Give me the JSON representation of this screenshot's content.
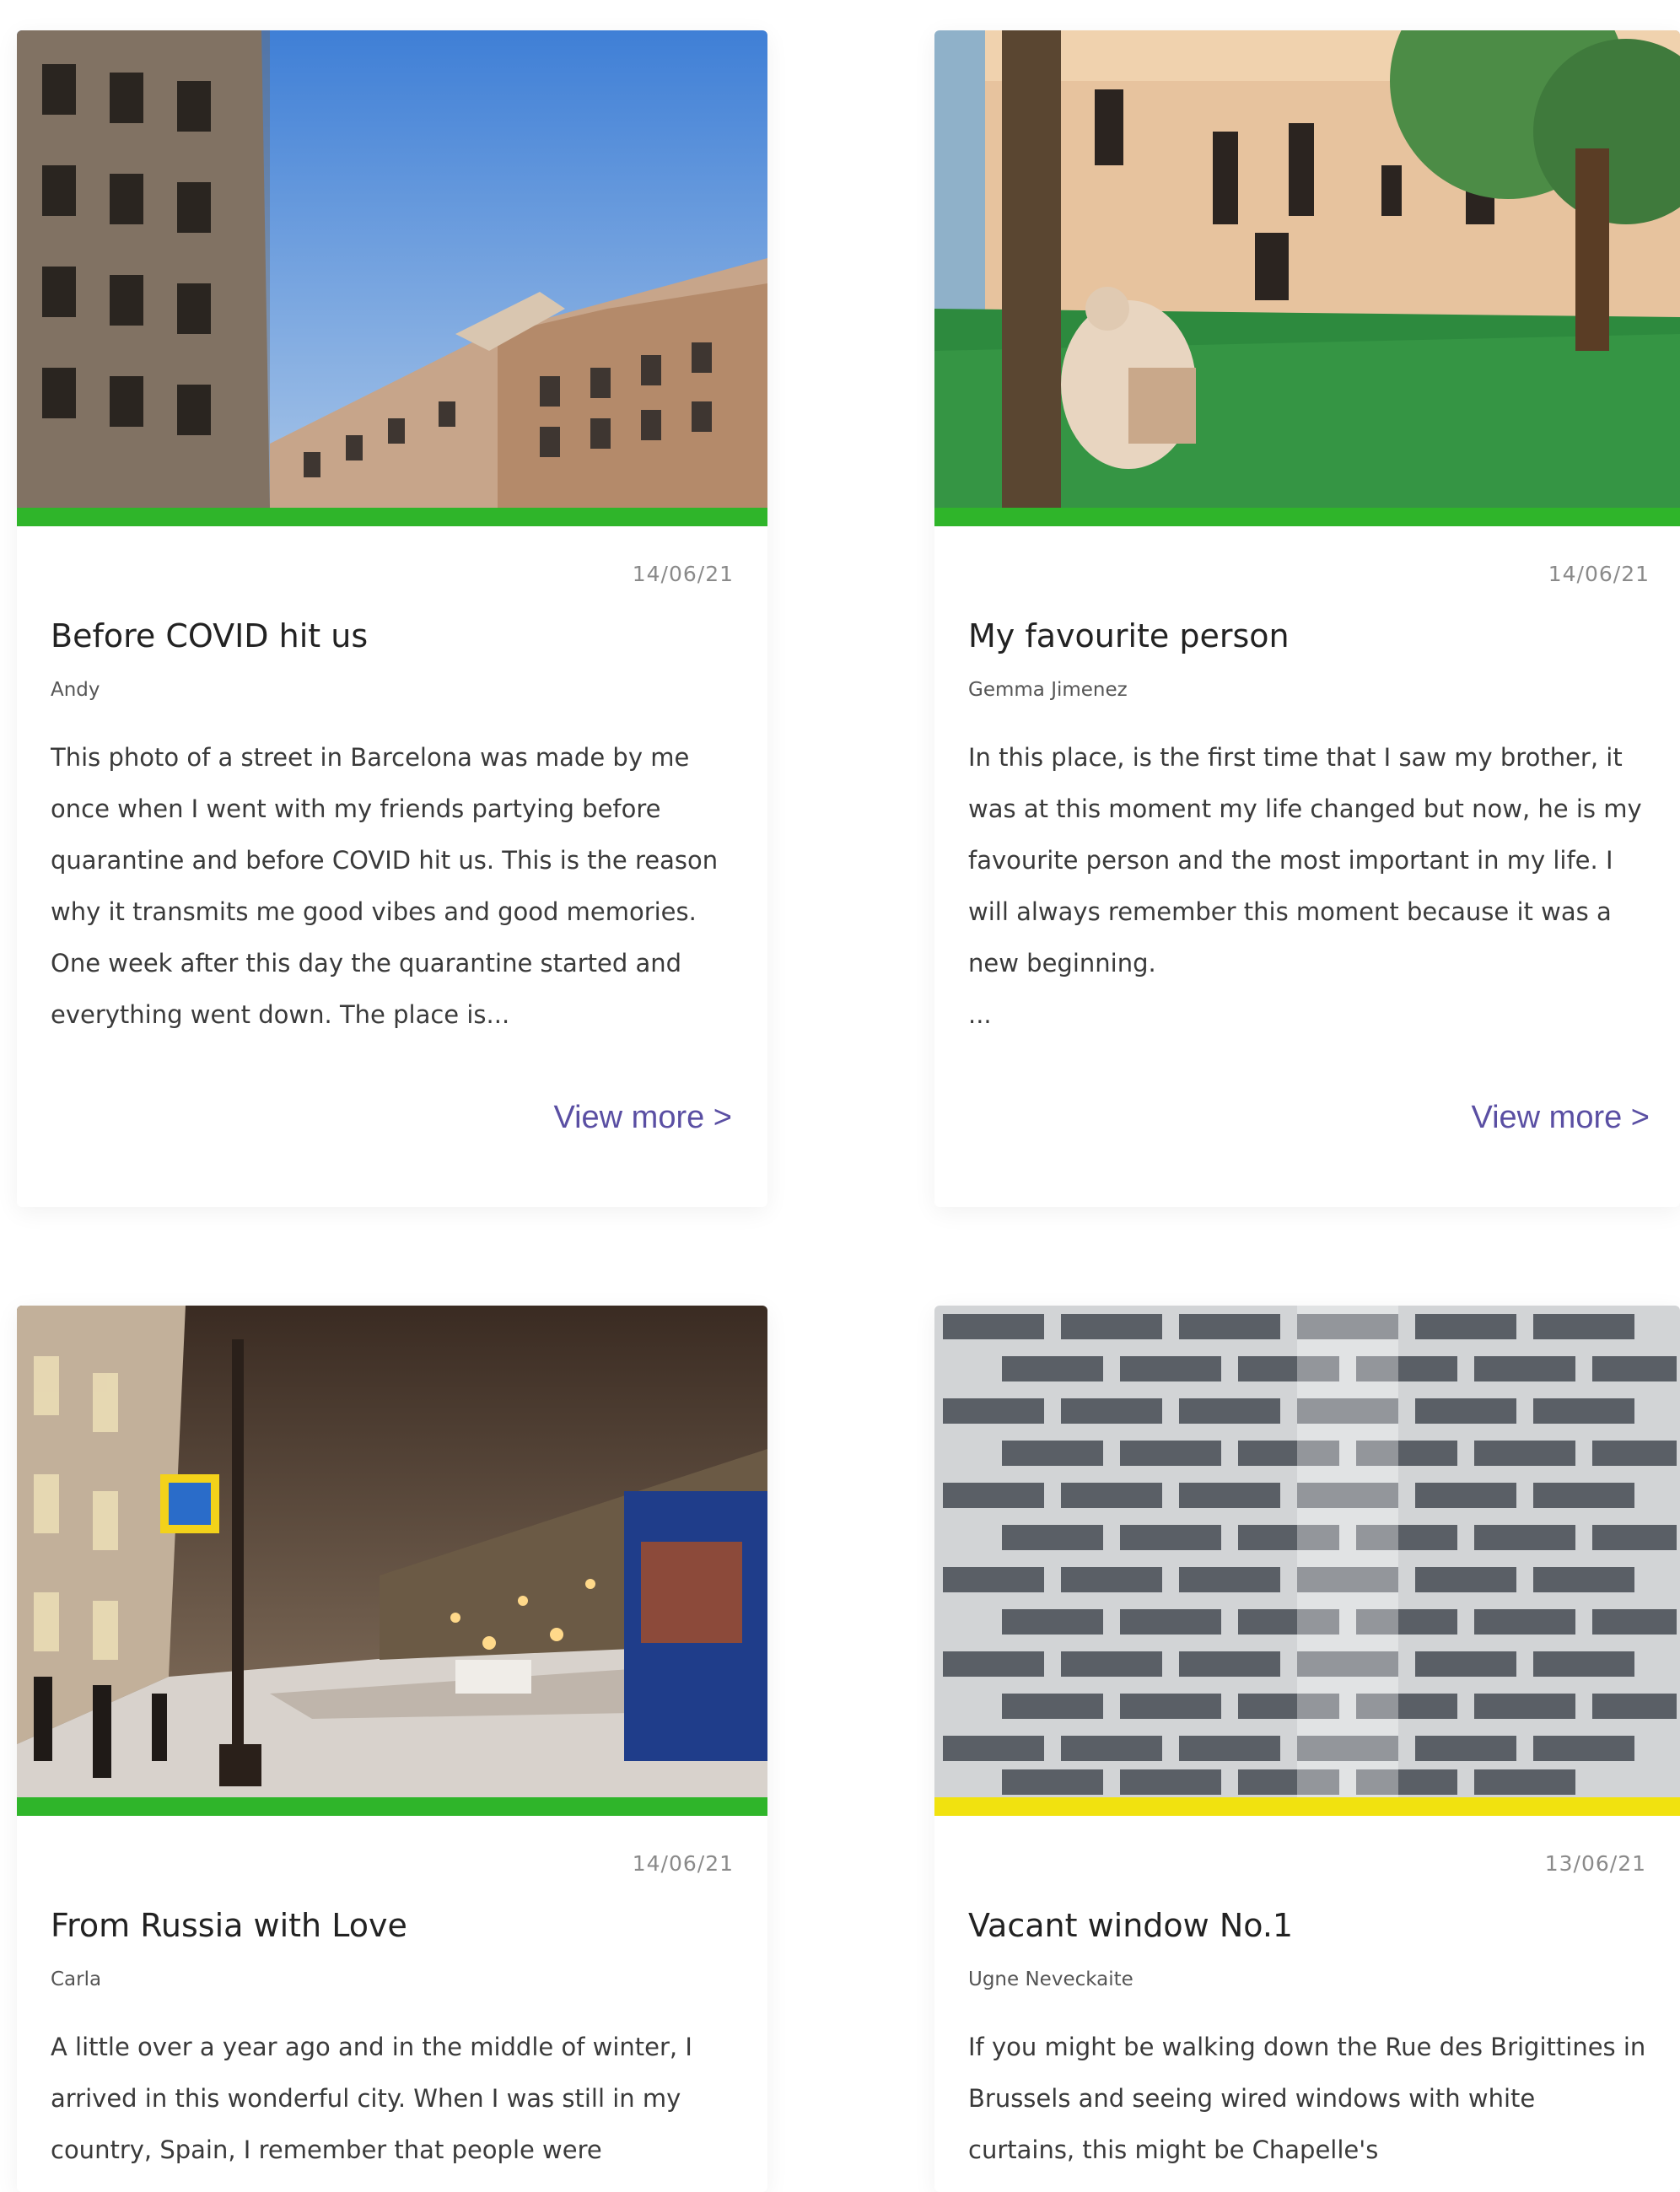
{
  "colors": {
    "accent_green": "#2fb52a",
    "accent_yellow": "#f1e20f",
    "link": "#5a4fa3"
  },
  "cards": [
    {
      "date": "14/06/21",
      "title": "Before COVID hit us",
      "author": "Andy",
      "excerpt": "This photo of a street in Barcelona was made by me once when I went with my friends partying before quarantine and before COVID hit us. This is the reason why it transmits me good vibes and good memories. One week after this day the quarantine started and everything went down. The place is...",
      "view_more": "View more >",
      "stripe_color": "#2fb52a"
    },
    {
      "date": "14/06/21",
      "title": "My favourite person",
      "author": "Gemma Jimenez",
      "excerpt": "In this place, is the first time that I saw my brother, it was at this moment my life changed but now, he is my favourite person and the most important in my life. I will always remember this moment because it was a new beginning.\n...",
      "view_more": "View more >",
      "stripe_color": "#2fb52a"
    },
    {
      "date": "14/06/21",
      "title": "From Russia with Love",
      "author": "Carla",
      "excerpt": "A little over a year ago and in the middle of winter, I arrived in this wonderful city. When I was still in my country, Spain, I remember that people were",
      "stripe_color": "#2fb52a"
    },
    {
      "date": "13/06/21",
      "title": "Vacant window No.1",
      "author": "Ugne Neveckaite",
      "excerpt": "If you might be walking down the Rue des Brigittines in Brussels and seeing wired windows with white curtains, this might be Chapelle's",
      "stripe_color": "#f1e20f"
    }
  ]
}
